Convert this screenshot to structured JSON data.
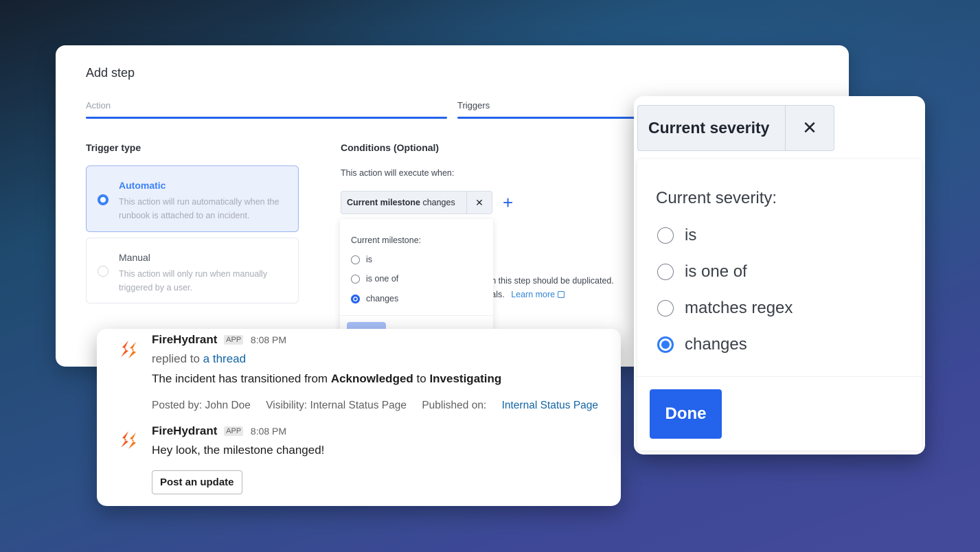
{
  "add_step": {
    "title": "Add step",
    "tabs": [
      {
        "label": "Action",
        "state": "completed"
      },
      {
        "label": "Triggers",
        "state": "active"
      }
    ],
    "trigger_type": {
      "heading": "Trigger type",
      "options": [
        {
          "title": "Automatic",
          "description": "This action will run automatically when the runbook is attached to an incident.",
          "selected": true
        },
        {
          "title": "Manual",
          "description": "This action will only run when manually triggered by a user.",
          "selected": false
        }
      ]
    },
    "conditions": {
      "heading": "Conditions (Optional)",
      "intro": "This action will execute when:",
      "chip": {
        "field": "Current milestone",
        "operator": "changes",
        "remove_icon": "close-icon"
      },
      "add_icon": "plus-icon",
      "duplication_text_1": "ch this step should be duplicated.",
      "duplication_text_2": "vals.",
      "learn_more": "Learn more",
      "popover": {
        "label": "Current milestone:",
        "options": [
          {
            "label": "is",
            "checked": false
          },
          {
            "label": "is one of",
            "checked": false
          },
          {
            "label": "changes",
            "checked": true
          }
        ]
      }
    }
  },
  "slack": {
    "messages": [
      {
        "sender": "FireHydrant",
        "badge": "APP",
        "time": "8:08 PM",
        "reply_prefix": "replied to",
        "reply_link": "a thread",
        "body_prefix": "The incident has transitioned from",
        "from_state": "Acknowledged",
        "body_mid": "to",
        "to_state": "Investigating",
        "meta": {
          "posted_by": "Posted by: John Doe",
          "visibility": "Visibility: Internal Status Page",
          "published_label": "Published on:",
          "published_link": "Internal Status Page"
        }
      },
      {
        "sender": "FireHydrant",
        "badge": "APP",
        "time": "8:08 PM",
        "body": "Hey look, the milestone changed!",
        "button": "Post an update"
      }
    ]
  },
  "severity_popover": {
    "chip_label": "Current severity",
    "remove_icon": "close-icon",
    "label": "Current severity:",
    "options": [
      {
        "label": "is",
        "checked": false
      },
      {
        "label": "is one of",
        "checked": false
      },
      {
        "label": "matches regex",
        "checked": false
      },
      {
        "label": "changes",
        "checked": true
      }
    ],
    "done": "Done"
  },
  "colors": {
    "accent": "#2563eb",
    "link": "#1264a3",
    "brand_orange": "#f4581e"
  }
}
